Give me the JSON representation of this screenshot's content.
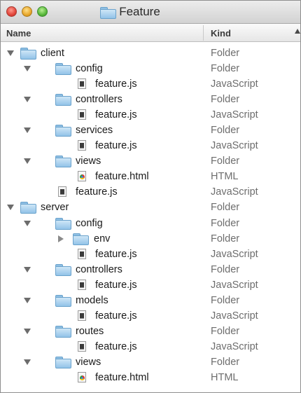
{
  "window": {
    "title": "Feature"
  },
  "columns": {
    "name": "Name",
    "kind": "Kind"
  },
  "rows": [
    {
      "name": "client",
      "kind": "Folder",
      "type": "folder",
      "depth": 0,
      "expand": "down"
    },
    {
      "name": "config",
      "kind": "Folder",
      "type": "folder",
      "depth": 1,
      "expand": "down"
    },
    {
      "name": "feature.js",
      "kind": "JavaScript",
      "type": "js",
      "depth": 2,
      "expand": ""
    },
    {
      "name": "controllers",
      "kind": "Folder",
      "type": "folder",
      "depth": 1,
      "expand": "down"
    },
    {
      "name": "feature.js",
      "kind": "JavaScript",
      "type": "js",
      "depth": 2,
      "expand": ""
    },
    {
      "name": "services",
      "kind": "Folder",
      "type": "folder",
      "depth": 1,
      "expand": "down"
    },
    {
      "name": "feature.js",
      "kind": "JavaScript",
      "type": "js",
      "depth": 2,
      "expand": ""
    },
    {
      "name": "views",
      "kind": "Folder",
      "type": "folder",
      "depth": 1,
      "expand": "down"
    },
    {
      "name": "feature.html",
      "kind": "HTML",
      "type": "html",
      "depth": 2,
      "expand": ""
    },
    {
      "name": "feature.js",
      "kind": "JavaScript",
      "type": "js",
      "depth": 1,
      "expand": ""
    },
    {
      "name": "server",
      "kind": "Folder",
      "type": "folder",
      "depth": 0,
      "expand": "down"
    },
    {
      "name": "config",
      "kind": "Folder",
      "type": "folder",
      "depth": 1,
      "expand": "down"
    },
    {
      "name": "env",
      "kind": "Folder",
      "type": "folder",
      "depth": 2,
      "expand": "right"
    },
    {
      "name": "feature.js",
      "kind": "JavaScript",
      "type": "js",
      "depth": 2,
      "expand": ""
    },
    {
      "name": "controllers",
      "kind": "Folder",
      "type": "folder",
      "depth": 1,
      "expand": "down"
    },
    {
      "name": "feature.js",
      "kind": "JavaScript",
      "type": "js",
      "depth": 2,
      "expand": ""
    },
    {
      "name": "models",
      "kind": "Folder",
      "type": "folder",
      "depth": 1,
      "expand": "down"
    },
    {
      "name": "feature.js",
      "kind": "JavaScript",
      "type": "js",
      "depth": 2,
      "expand": ""
    },
    {
      "name": "routes",
      "kind": "Folder",
      "type": "folder",
      "depth": 1,
      "expand": "down"
    },
    {
      "name": "feature.js",
      "kind": "JavaScript",
      "type": "js",
      "depth": 2,
      "expand": ""
    },
    {
      "name": "views",
      "kind": "Folder",
      "type": "folder",
      "depth": 1,
      "expand": "down"
    },
    {
      "name": "feature.html",
      "kind": "HTML",
      "type": "html",
      "depth": 2,
      "expand": ""
    }
  ]
}
